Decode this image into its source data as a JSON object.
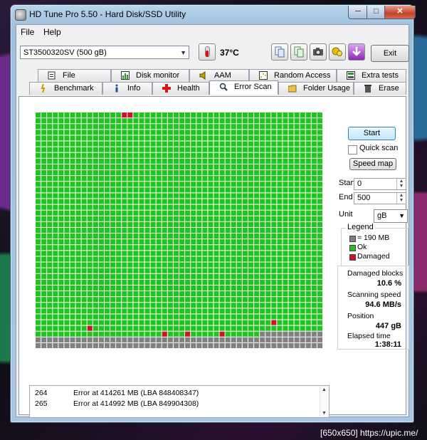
{
  "window": {
    "title": "HD Tune Pro 5.50 - Hard Disk/SSD Utility",
    "min_glyph": "─",
    "max_glyph": "□",
    "close_glyph": "✕"
  },
  "menu": [
    {
      "label": "File"
    },
    {
      "label": "Help"
    }
  ],
  "toolbar": {
    "drive": "ST3500320SV (500 gB)",
    "temperature": "37°C",
    "exit_label": "Exit"
  },
  "tabs": {
    "row1": [
      "File Benchmark",
      "Disk monitor",
      "AAM",
      "Random Access",
      "Extra tests"
    ],
    "row2": [
      "Benchmark",
      "Info",
      "Health",
      "Error Scan",
      "Folder Usage",
      "Erase"
    ],
    "active": "Error Scan"
  },
  "controls": {
    "start_label": "Start",
    "quick_scan_label": "Quick scan",
    "quick_scan_checked": false,
    "speed_map_label": "Speed map",
    "start_field_label": "Start",
    "start_value": "0",
    "end_field_label": "End",
    "end_value": "500",
    "unit_label": "Unit",
    "unit_value": "gB"
  },
  "legend": {
    "title": "Legend",
    "items": [
      {
        "label": "= 190 MB",
        "color": "#808080"
      },
      {
        "label": "Ok",
        "color": "#21c41f"
      },
      {
        "label": "Damaged",
        "color": "#d0112b"
      }
    ]
  },
  "stats": {
    "damaged_blocks_label": "Damaged blocks",
    "damaged_blocks_value": "10.6 %",
    "scanning_speed_label": "Scanning speed",
    "scanning_speed_value": "94.6 MB/s",
    "position_label": "Position",
    "position_value": "447 gB",
    "elapsed_label": "Elapsed time",
    "elapsed_value": "1:38:11"
  },
  "log": [
    {
      "num": "264",
      "text": "Error at 414261 MB (LBA 848408347)"
    },
    {
      "num": "265",
      "text": "Error at 414992 MB (LBA 849904308)"
    }
  ],
  "scan_grid": {
    "columns": 50,
    "rows": 41,
    "colors": {
      "ok": "#21c41f",
      "damaged": "#d0112b",
      "unscanned": "#808080",
      "line": "#0a5a0a"
    },
    "scanned_full_rows": 38,
    "scanned_cols_in_row_38": 39,
    "damaged_cells": [
      [
        0,
        15
      ],
      [
        0,
        16
      ],
      [
        37,
        9
      ],
      [
        38,
        22
      ],
      [
        38,
        26
      ],
      [
        38,
        32
      ],
      [
        36,
        41
      ]
    ]
  },
  "watermark": "[650x650] https://upic.me/"
}
